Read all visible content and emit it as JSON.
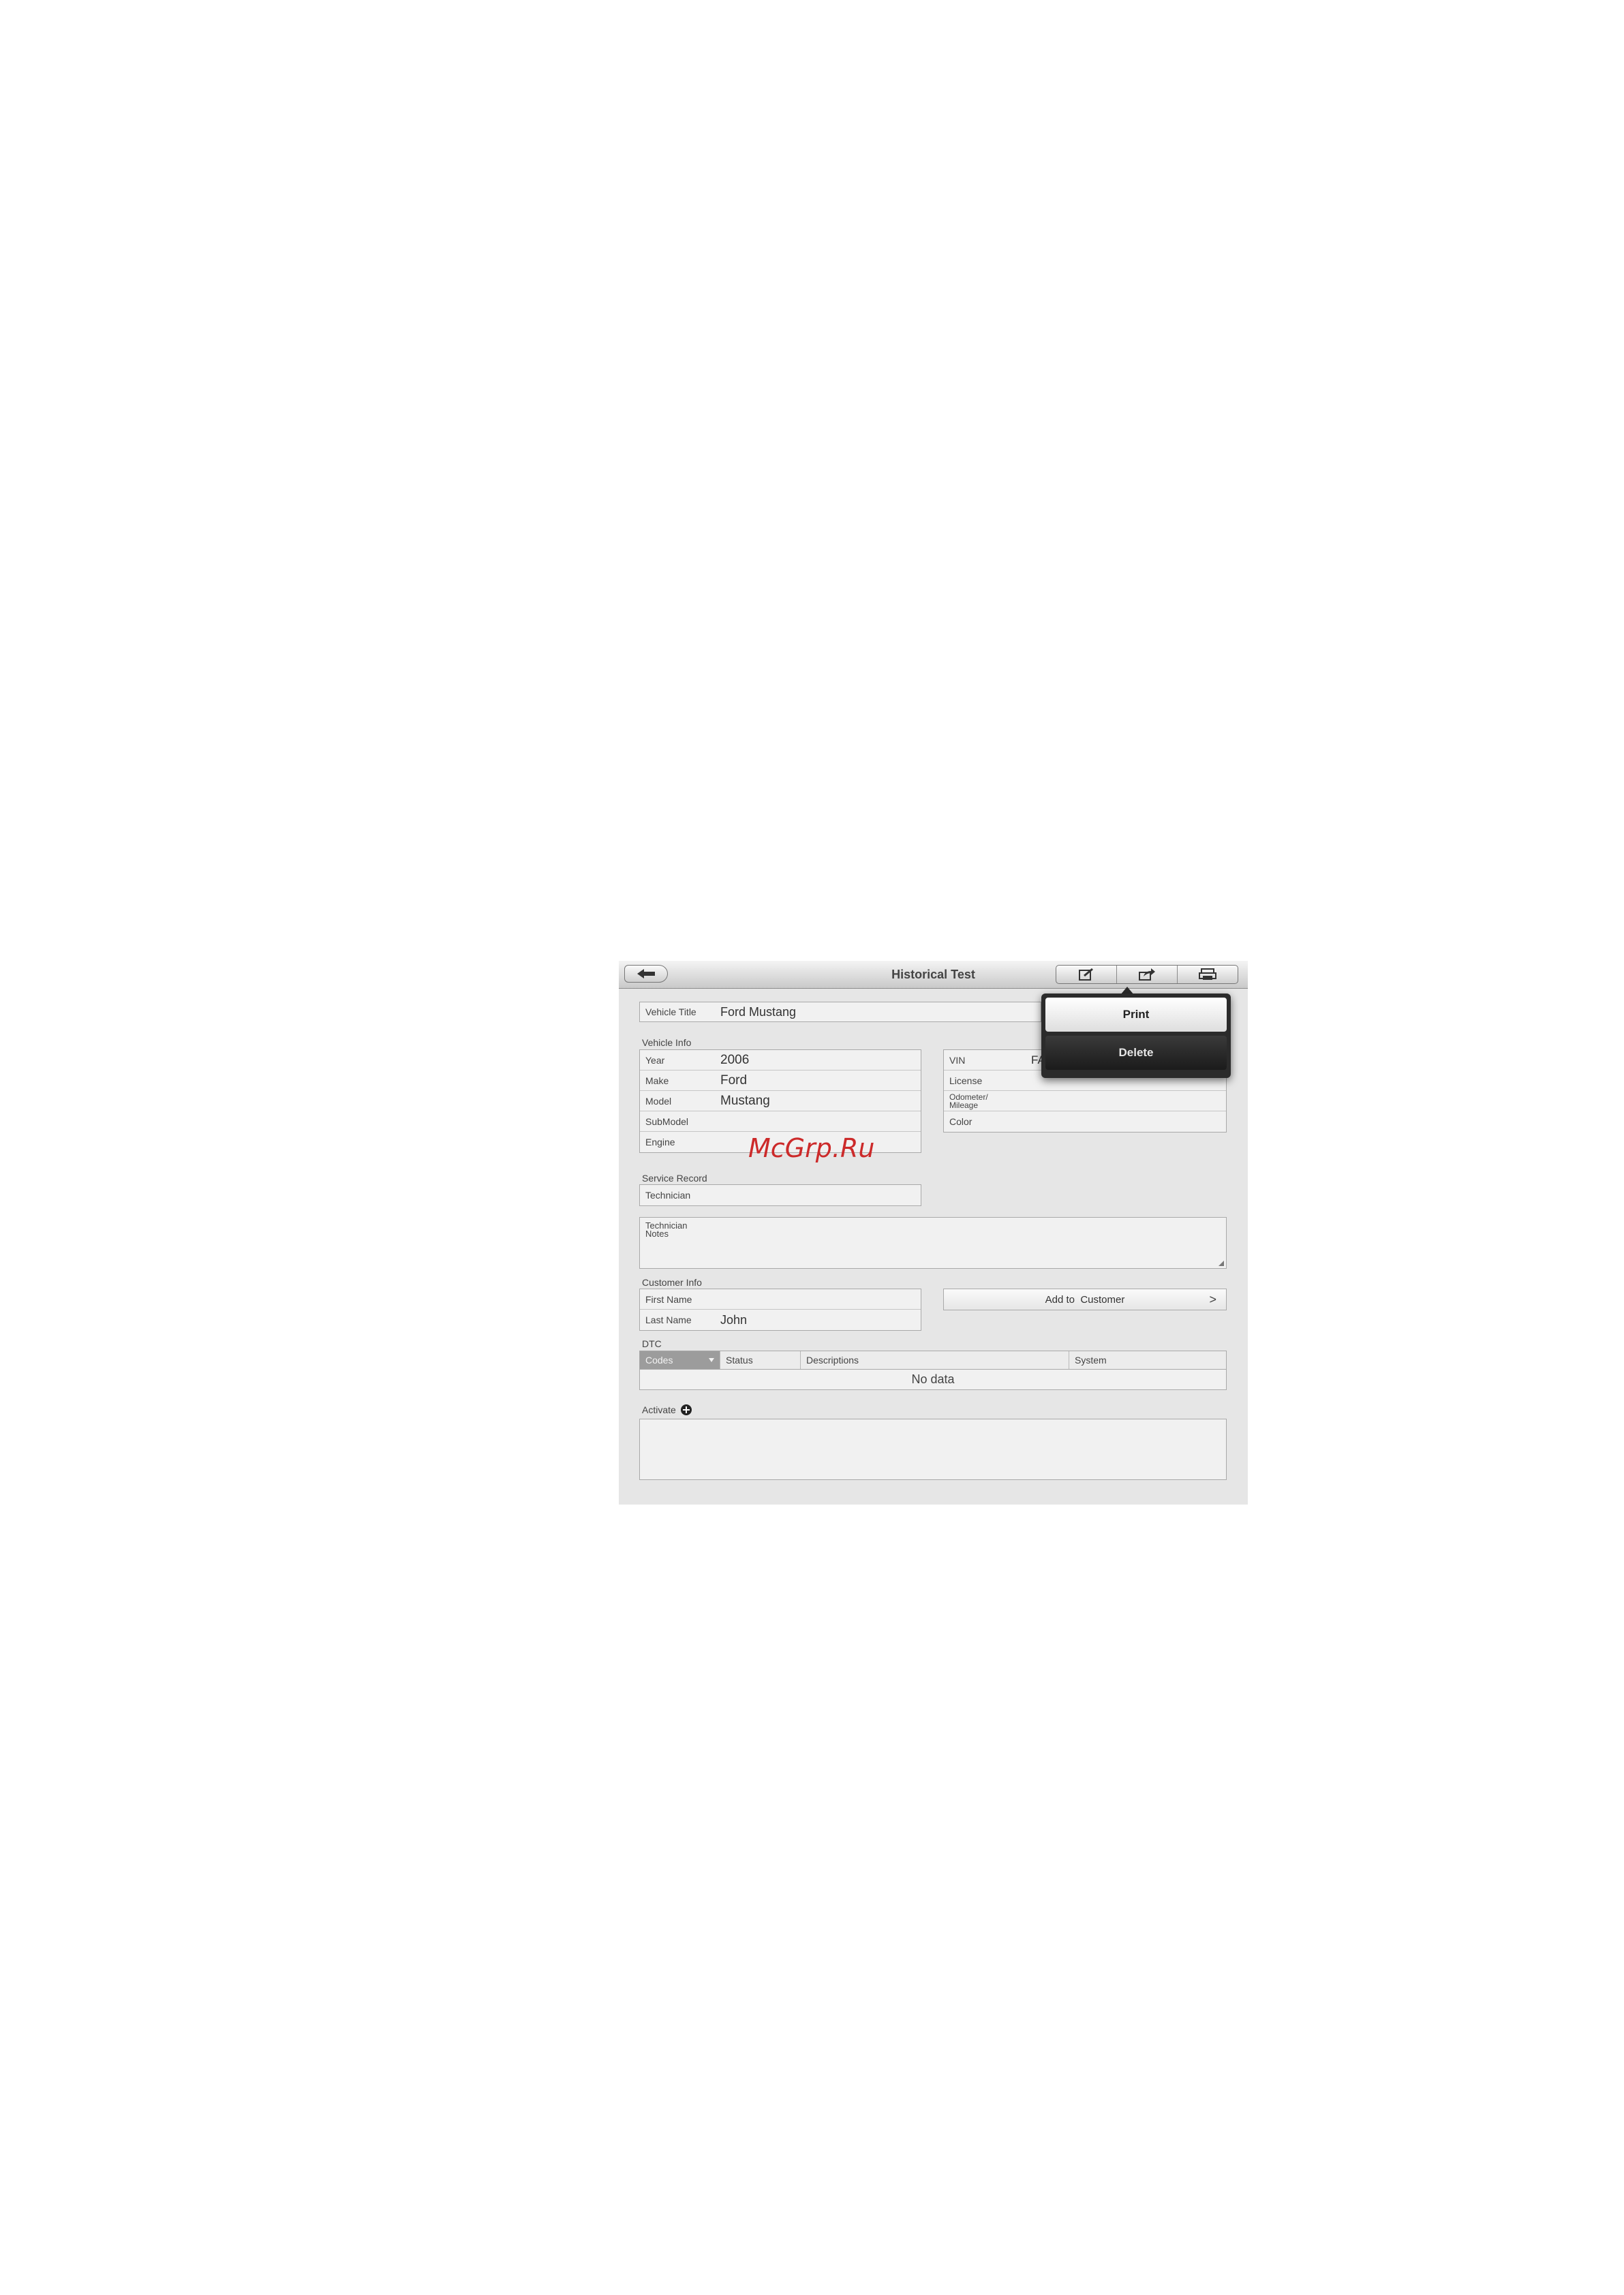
{
  "header": {
    "title": "Historical Test",
    "back_icon": "back-arrow-icon",
    "tools": [
      "edit-icon",
      "share-icon",
      "print-stack-icon"
    ]
  },
  "menu": {
    "print_label": "Print",
    "delete_label": "Delete"
  },
  "vehicle_title": {
    "label": "Vehicle Title",
    "value": "Ford Mustang"
  },
  "vehicle_info": {
    "section_label": "Vehicle Info",
    "left_rows": [
      {
        "label": "Year",
        "value": "2006"
      },
      {
        "label": "Make",
        "value": "Ford"
      },
      {
        "label": "Model",
        "value": "Mustang"
      },
      {
        "label": "SubModel",
        "value": ""
      },
      {
        "label": "Engine",
        "value": ""
      }
    ],
    "right_rows": [
      {
        "label": "VIN",
        "value": "FA"
      },
      {
        "label": "License",
        "value": ""
      },
      {
        "label": "Odometer/ Mileage",
        "value": ""
      },
      {
        "label": "Color",
        "value": ""
      }
    ]
  },
  "service_record": {
    "section_label": "Service Record",
    "technician_label": "Technician",
    "notes_label": "Technician Notes"
  },
  "customer_info": {
    "section_label": "Customer Info",
    "first_name_label": "First Name",
    "first_name_value": "",
    "last_name_label": "Last Name",
    "last_name_value": "John",
    "add_button_label": "Add to  Customer",
    "add_button_chevron": ">"
  },
  "dtc": {
    "section_label": "DTC",
    "columns": [
      "Codes",
      "Status",
      "Descriptions",
      "System"
    ],
    "empty_text": "No data"
  },
  "activate": {
    "label": "Activate"
  },
  "watermark": "McGrp.Ru"
}
